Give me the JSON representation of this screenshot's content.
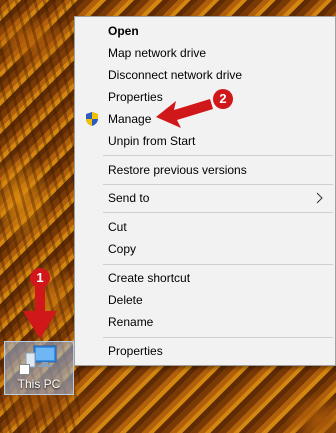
{
  "context_menu": {
    "items": [
      {
        "label": "Open",
        "bold": true
      },
      {
        "label": "Map network drive"
      },
      {
        "label": "Disconnect network drive"
      },
      {
        "label": "Properties"
      },
      {
        "label": "Manage",
        "icon": "uac-shield-icon"
      },
      {
        "label": "Unpin from Start"
      },
      {
        "label": "Restore previous versions"
      },
      {
        "label": "Send to",
        "submenu": true
      },
      {
        "label": "Cut"
      },
      {
        "label": "Copy"
      },
      {
        "label": "Create shortcut"
      },
      {
        "label": "Delete"
      },
      {
        "label": "Rename"
      },
      {
        "label": "Properties"
      }
    ]
  },
  "desktop_icon": {
    "label": "This PC",
    "icon": "this-pc-icon"
  },
  "annotations": {
    "step1": "1",
    "step2": "2",
    "color": "#d0171a"
  }
}
